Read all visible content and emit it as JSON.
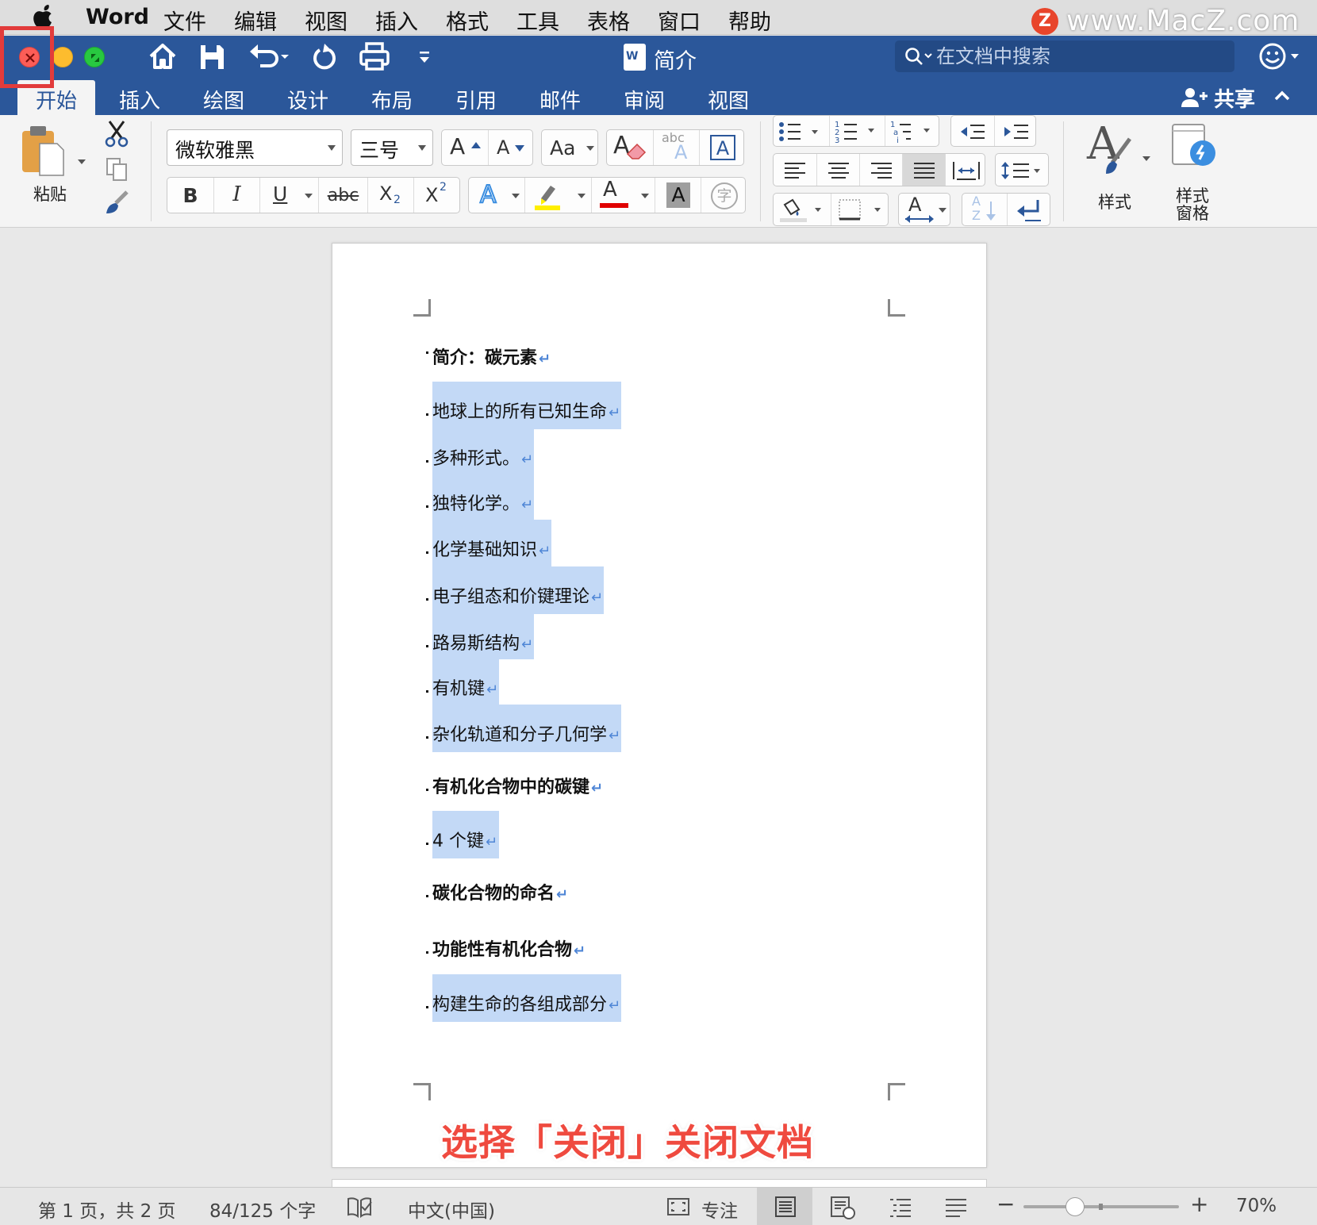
{
  "menubar": {
    "app_name": "Word",
    "items": [
      "文件",
      "编辑",
      "视图",
      "插入",
      "格式",
      "工具",
      "表格",
      "窗口",
      "帮助"
    ],
    "watermark": "www.MacZ.com",
    "watermark_logo": "Z"
  },
  "titlebar": {
    "doc_title": "简介",
    "search_placeholder": "在文档中搜索"
  },
  "tabs": {
    "items": [
      "开始",
      "插入",
      "绘图",
      "设计",
      "布局",
      "引用",
      "邮件",
      "审阅",
      "视图"
    ],
    "active": "开始",
    "share_label": "共享"
  },
  "ribbon": {
    "paste_label": "粘贴",
    "font_name": "微软雅黑",
    "font_size": "三号",
    "styles_label": "样式",
    "styles_pane_label_1": "样式",
    "styles_pane_label_2": "窗格",
    "grow_font": "A",
    "shrink_font": "A",
    "change_case": "Aa",
    "bold": "B",
    "italic": "I",
    "underline": "U",
    "strikethrough": "abc",
    "subscript": "X",
    "subscript_small": "2",
    "superscript": "X",
    "superscript_small": "2",
    "text_effects": "A",
    "font_color": "A",
    "char_shading": "A",
    "enclose_char": "字",
    "phonetic_small": "abc",
    "phonetic_big": "A",
    "char_border": "A",
    "clear_format": "A",
    "styles_big_letter": "A",
    "text_direction": "A",
    "sort_small": "A",
    "sort_small_2": "Z",
    "colors": {
      "highlight": "#ffef00",
      "font_color": "#e00000",
      "accent": "#2b579a"
    }
  },
  "document": {
    "paragraphs": [
      {
        "text": "简介：碳元素",
        "bold": true,
        "selected": false
      },
      {
        "text": "地球上的所有已知生命",
        "bold": false,
        "selected": true
      },
      {
        "text": "多种形式。",
        "bold": false,
        "selected": true
      },
      {
        "text": "独特化学。",
        "bold": false,
        "selected": true
      },
      {
        "text": "化学基础知识",
        "bold": false,
        "selected": true
      },
      {
        "text": "电子组态和价键理论",
        "bold": false,
        "selected": true
      },
      {
        "text": "路易斯结构",
        "bold": false,
        "selected": true
      },
      {
        "text": "有机键",
        "bold": false,
        "selected": true
      },
      {
        "text": "杂化轨道和分子几何学",
        "bold": false,
        "selected": true
      },
      {
        "text": "有机化合物中的碳键",
        "bold": true,
        "selected": false
      },
      {
        "text": "4 个键",
        "bold": false,
        "selected": true
      },
      {
        "text": "碳化合物的命名",
        "bold": true,
        "selected": false
      },
      {
        "text": "功能性有机化合物",
        "bold": true,
        "selected": false
      },
      {
        "text": "构建生命的各组成部分",
        "bold": false,
        "selected": true
      }
    ],
    "paragraph_mark": "↵",
    "caption": "选择「关闭」关闭文档"
  },
  "statusbar": {
    "page_info": "第 1 页，共 2 页",
    "word_count": "84/125 个字",
    "language": "中文(中国)",
    "focus_label": "专注",
    "zoom_minus": "−",
    "zoom_plus": "+",
    "zoom": "70%",
    "zoom_level_fraction": 0.33
  }
}
